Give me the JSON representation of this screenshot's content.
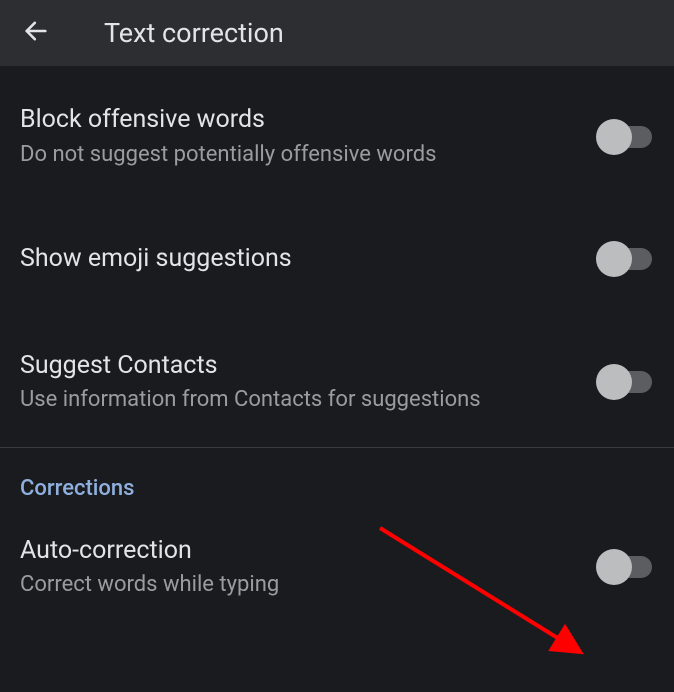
{
  "header": {
    "title": "Text correction"
  },
  "settings": [
    {
      "title": "Block offensive words",
      "desc": "Do not suggest potentially offensive words"
    },
    {
      "title": "Show emoji suggestions",
      "desc": ""
    },
    {
      "title": "Suggest Contacts",
      "desc": "Use information from Contacts for suggestions"
    }
  ],
  "section_label": "Corrections",
  "corrections": [
    {
      "title": "Auto-correction",
      "desc": "Correct words while typing"
    }
  ]
}
